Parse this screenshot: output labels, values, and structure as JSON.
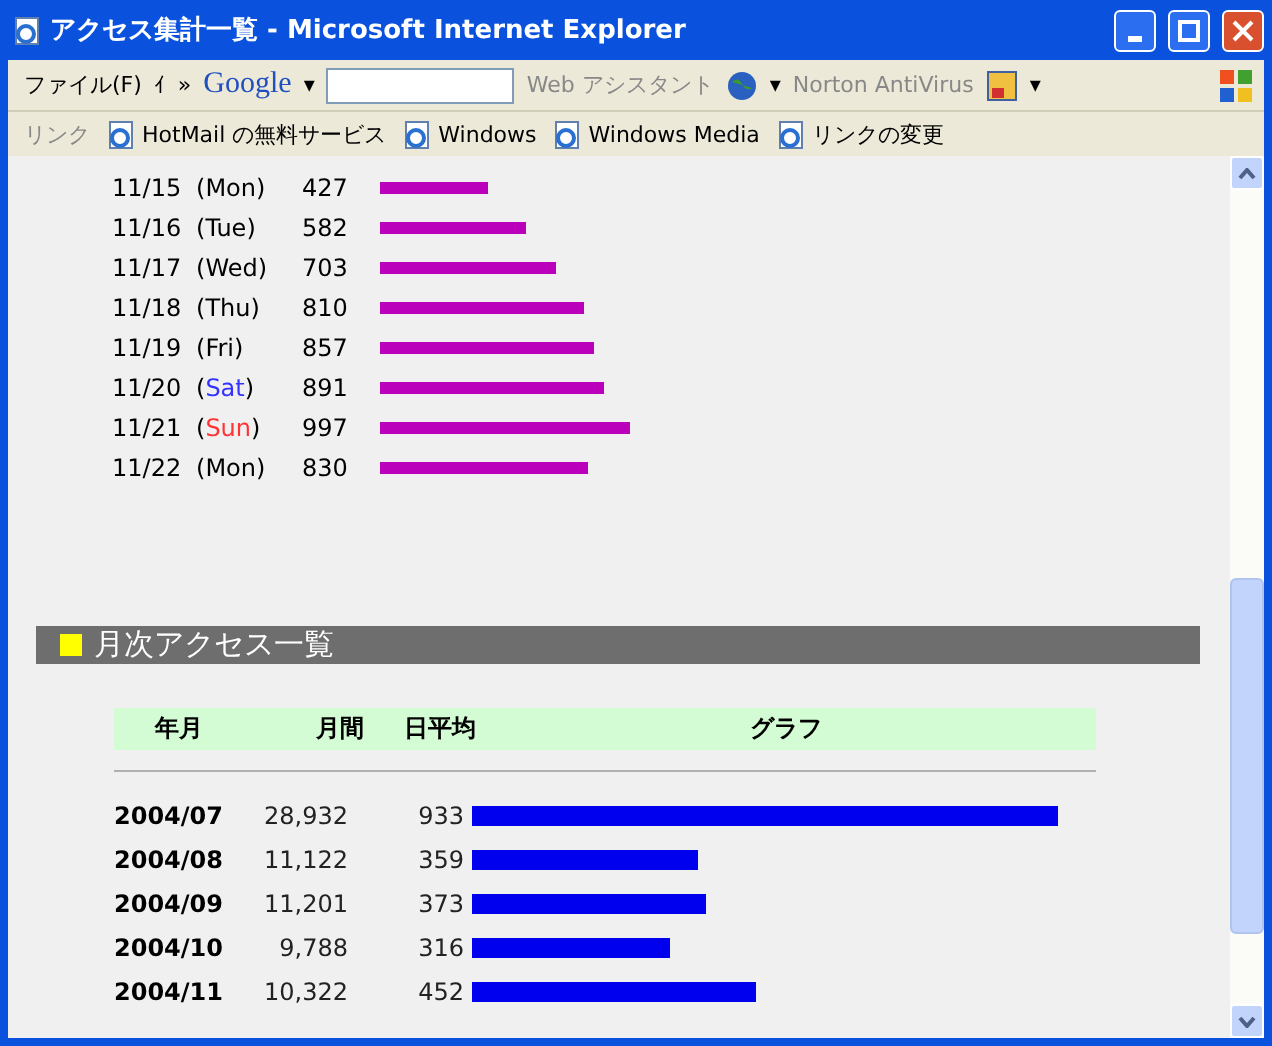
{
  "window": {
    "title": "アクセス集計一覧 - Microsoft Internet Explorer"
  },
  "toolbar": {
    "menu": "ファイル(F)",
    "menu_cut": "ｲ",
    "chevron": "»",
    "search_brand": "Google",
    "search_caret": "▾",
    "assistant": "Web アシスタント",
    "assistant_caret": "▾",
    "antivirus": "Norton AntiVirus",
    "antivirus_caret": "▾"
  },
  "links": {
    "label": "リンク",
    "items": [
      "HotMail の無料サービス",
      "Windows",
      "Windows Media",
      "リンクの変更"
    ]
  },
  "daily": [
    {
      "date": "11/15",
      "paren_open": "(",
      "weekday": "Mon",
      "paren_close": ")",
      "count": "427"
    },
    {
      "date": "11/16",
      "paren_open": "(",
      "weekday": "Tue",
      "paren_close": ")",
      "count": "582"
    },
    {
      "date": "11/17",
      "paren_open": "(",
      "weekday": "Wed",
      "paren_close": ")",
      "count": "703"
    },
    {
      "date": "11/18",
      "paren_open": "(",
      "weekday": "Thu",
      "paren_close": ")",
      "count": "810"
    },
    {
      "date": "11/19",
      "paren_open": "(",
      "weekday": "Fri",
      "paren_close": ")",
      "count": "857"
    },
    {
      "date": "11/20",
      "paren_open": "(",
      "weekday": "Sat",
      "paren_close": ")",
      "count": "891",
      "color": "#3333ff"
    },
    {
      "date": "11/21",
      "paren_open": "(",
      "weekday": "Sun",
      "paren_close": ")",
      "count": "997",
      "color": "#ff3333"
    },
    {
      "date": "11/22",
      "paren_open": "(",
      "weekday": "Mon",
      "paren_close": ")",
      "count": "830"
    }
  ],
  "monthly": {
    "title": "月次アクセス一覧",
    "columns": [
      "年月",
      "月間",
      "日平均",
      "グラフ"
    ],
    "rows": [
      {
        "month": "2004/07",
        "total": "28,932",
        "average": "933"
      },
      {
        "month": "2004/08",
        "total": "11,122",
        "average": "359"
      },
      {
        "month": "2004/09",
        "total": "11,201",
        "average": "373"
      },
      {
        "month": "2004/10",
        "total": "9,788",
        "average": "316"
      },
      {
        "month": "2004/11",
        "total": "10,322",
        "average": "452"
      }
    ]
  }
}
